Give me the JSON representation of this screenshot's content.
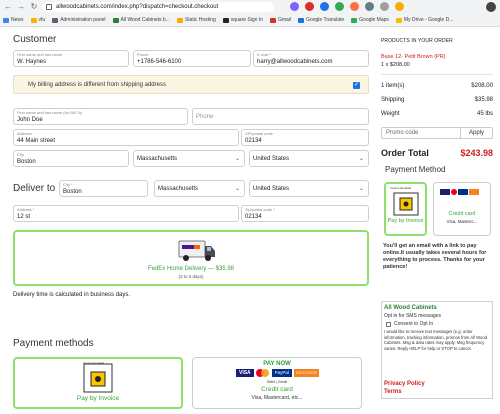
{
  "browser": {
    "url": "allwoodcabinets.com/index.php?dispatch=checkout.checkout",
    "bookmarks": [
      "News",
      "vfu",
      "Administration panel",
      "All Wood Cabinets b...",
      "Static Hosting",
      "square Sign In",
      "Gmail",
      "Google Translate",
      "Google Maps",
      "My Drive - Google D..."
    ],
    "bookmark_colors": [
      "#4285f4",
      "#f4b400",
      "#5f6368",
      "#2e7d32",
      "#f9ab00",
      "#222222",
      "#d93025",
      "#1a73e8",
      "#34a853",
      "#fbbc04"
    ],
    "extension_colors": [
      "#7b61ff",
      "#d93025",
      "#1a73e8",
      "#34a853",
      "#ff7043",
      "#607d8b",
      "#9e9e9e",
      "#f9ab00"
    ]
  },
  "customer": {
    "heading": "Customer",
    "first_name_label": "First name and last name",
    "first_name": "W. Haynes",
    "phone_label": "Phone",
    "phone": "+1786-546-6100",
    "email_label": "E-mail *",
    "email": "harry@allwoodcabinets.com",
    "billing_diff": "My billing address is different from shipping address",
    "billing_checked": "✓"
  },
  "billing": {
    "name_label": "First name and last name (for Bill To)",
    "name": "John Doe",
    "phone_placeholder": "Phone",
    "address_label": "Address",
    "address": "44 Main street",
    "zip_label": "ZIP/postal code",
    "zip": "02134",
    "city_label": "City",
    "city": "Boston",
    "state": "Massachusetts",
    "country": "United States"
  },
  "deliver": {
    "heading": "Deliver to",
    "city_label": "City *",
    "city": "Boston",
    "state": "Massachusetts",
    "country": "United States",
    "address_label": "Address *",
    "address": "12 st",
    "zip_label": "Zip/postal code *",
    "zip": "02134"
  },
  "shipping": {
    "label": "FedEx Home Delivery — $35.98",
    "days": "(3 to 5 days)",
    "note": "Delivery time is calculated in business days."
  },
  "payment": {
    "heading": "Payment methods",
    "invoice_label": "Pay by Invoice",
    "invoice_badge_text": "Invoice Emailed",
    "card_title": "PAY NOW",
    "card_label": "Credit card",
    "card_sub": "Visa, Mastercard, etc...",
    "card_sub_short": "Visa, Masterc...",
    "card_brands": [
      "VISA",
      "PayPal",
      "DISCOVER"
    ],
    "card_mc_text": "Debit | Credit"
  },
  "order": {
    "title": "PRODUCTS IN YOUR ORDER",
    "product": "Base 12- Petit Brown (PR)",
    "qty": "1 x $208.00",
    "items_label": "1 item(s)",
    "items_value": "$208.00",
    "shipping_label": "Shipping",
    "shipping_value": "$35.98",
    "weight_label": "Weight",
    "weight_value": "45 lbs",
    "promo_placeholder": "Promo code",
    "apply_label": "Apply",
    "total_label": "Order Total",
    "total_value": "$243.98",
    "payment_method_heading": "Payment Method",
    "message": "You'll get an email with a link to pay online.It usually takes several hours for everything to process. Thanks for your patience!"
  },
  "sms": {
    "brand": "All Wood Cabinets",
    "opt_in_text": "Opt in for SMS messages",
    "consent_label": "Consent to Opt In",
    "legal": "I would like to receive text messages (e.g. order information, tracking information, promos from All Wood Cabinets. Msg & data rates may apply. Msg frequency varies. Reply HELP for help or STOP to cancel.",
    "privacy": "Privacy Policy",
    "terms": "Terms"
  },
  "colors": {
    "accent_green": "#8ee06d",
    "price_red": "#cc1f1f",
    "link_green": "#3aa33a"
  }
}
